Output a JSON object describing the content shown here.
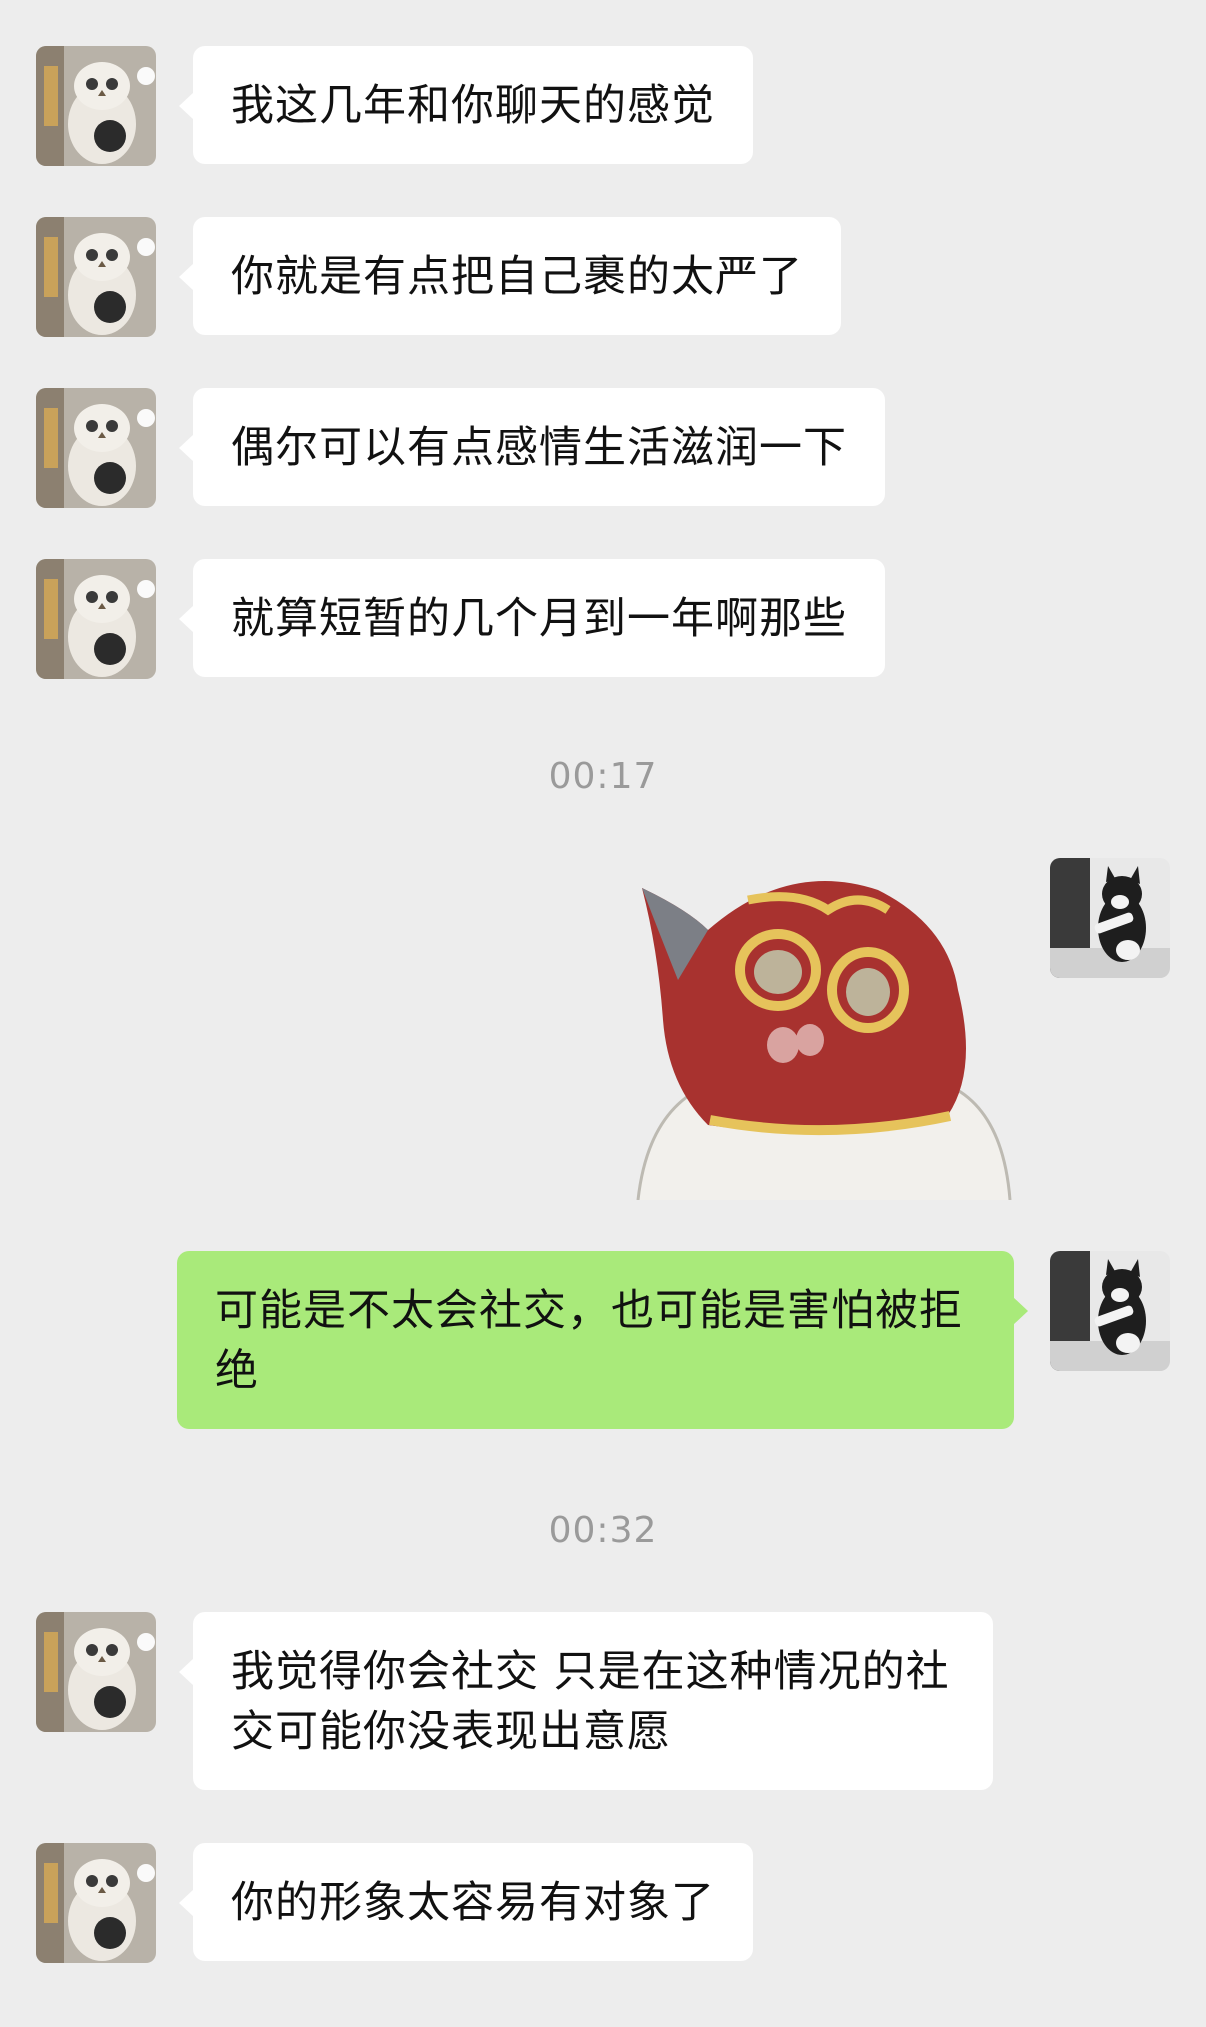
{
  "chat": {
    "messages": [
      {
        "sender": "other",
        "text": "我这几年和你聊天的感觉"
      },
      {
        "sender": "other",
        "text": "你就是有点把自己裹的太严了"
      },
      {
        "sender": "other",
        "text": "偶尔可以有点感情生活滋润一下"
      },
      {
        "sender": "other",
        "text": "就算短暂的几个月到一年啊那些"
      },
      {
        "sender": "me",
        "type": "sticker",
        "description": "masked-owl-sticker"
      },
      {
        "sender": "me",
        "text": "可能是不太会社交，也可能是害怕被拒绝"
      },
      {
        "sender": "other",
        "text": "我觉得你会社交 只是在这种情况的社交可能你没表现出意愿"
      },
      {
        "sender": "other",
        "text": "你的形象太容易有对象了"
      }
    ],
    "timestamps": [
      "00:17",
      "00:32"
    ]
  },
  "colors": {
    "background": "#ededed",
    "incoming_bubble": "#ffffff",
    "outgoing_bubble": "#a9ea7a",
    "timestamp_text": "#9a9a9a"
  }
}
